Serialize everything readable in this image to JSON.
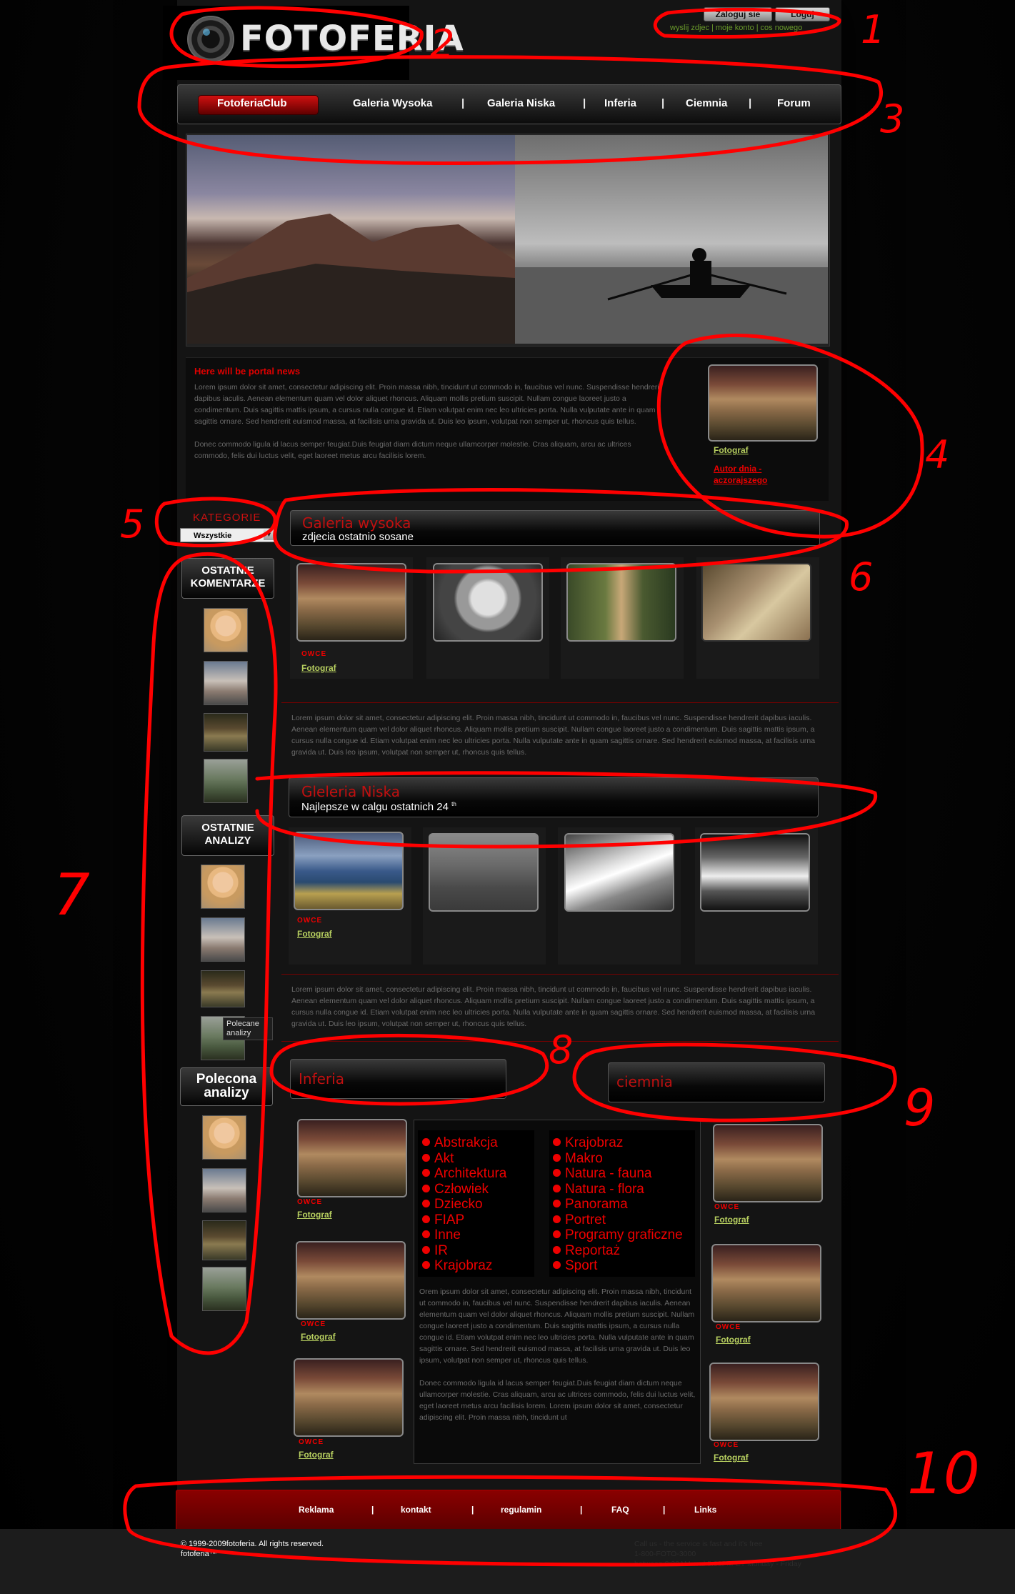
{
  "header": {
    "logo_text": "FOTOFERIA",
    "login_button": "Zaloguj sie",
    "logout_button": "Loguj",
    "top_links": [
      "wyslij zdjec",
      "moje konto",
      "cos nowego"
    ]
  },
  "nav": {
    "items": [
      "FotoferiaClub",
      "Galeria Wysoka",
      "Galeria Niska",
      "Inferia",
      "Ciemnia",
      "Forum"
    ],
    "separator": "|"
  },
  "news": {
    "title": "Here will be portal news",
    "paragraph1": "Lorem ipsum dolor sit amet, consectetur adipiscing elit. Proin massa nibh, tincidunt ut commodo in, faucibus vel nunc. Suspendisse hendrerit dapibus iaculis. Aenean elementum quam vel dolor aliquet rhoncus. Aliquam mollis pretium suscipit. Nullam congue laoreet justo a condimentum. Duis sagittis mattis ipsum, a cursus nulla congue id. Etiam volutpat enim nec leo ultricies porta. Nulla vulputate ante in quam sagittis ornare. Sed hendrerit euismod massa, at facilisis urna gravida ut. Duis leo ipsum, volutpat non semper ut, rhoncus quis tellus.",
    "paragraph2": "Donec commodo ligula id lacus semper feugiat.Duis feugiat diam dictum neque ullamcorper molestie. Cras aliquam, arcu ac ultrices commodo, felis dui luctus velit, eget laoreet metus arcu facilisis lorem."
  },
  "author_of_day": {
    "photographer_link": "Fotograf",
    "author_link": "Autor dnia - aczorajszego"
  },
  "sidebar": {
    "category_label": "KATEGORIE",
    "category_selected": "Wszystkie",
    "recent_comments": "OSTATNIE KOMENTARZE",
    "recent_analyses": "OSTATNIE ANALIZY",
    "recommended": "Polecona analizy",
    "tooltip": "Polecane analizy"
  },
  "gallery_high": {
    "title": "Galeria wysoka",
    "subtitle": "zdjecia ostatnio sosane",
    "caption_tag": "OWCE",
    "caption_link": "Fotograf"
  },
  "gallery_low": {
    "title": "Gleleria Niska",
    "subtitle": "Najlepsze w calgu ostatnich 24",
    "subtitle_sup": "th",
    "caption_tag": "OWCE",
    "caption_link": "Fotograf"
  },
  "lorem_block": "Lorem ipsum dolor sit amet, consectetur adipiscing elit. Proin massa nibh, tincidunt ut commodo in, faucibus vel nunc. Suspendisse hendrerit dapibus iaculis. Aenean elementum quam vel dolor aliquet rhoncus. Aliquam mollis pretium suscipit. Nullam congue laoreet justo a condimentum. Duis sagittis mattis ipsum, a cursus nulla congue id. Etiam volutpat enim nec leo ultricies porta. Nulla vulputate ante in quam sagittis ornare. Sed hendrerit euismod massa, at facilisis urna gravida ut. Duis leo ipsum, volutpat non semper ut, rhoncus quis tellus.",
  "inferia": {
    "title": "Inferia",
    "caption_tag": "OWCE",
    "caption_link": "Fotograf"
  },
  "ciemnia": {
    "title": "ciemnia",
    "caption_tag": "OWCE",
    "caption_link": "Fotograf"
  },
  "categories": {
    "left": [
      "Abstrakcja",
      "Akt",
      "Architektura",
      "Człowiek",
      "Dziecko",
      "FIAP",
      "Inne",
      "IR",
      "Krajobraz"
    ],
    "right": [
      "Krajobraz",
      "Makro",
      "Natura - fauna",
      "Natura - flora",
      "Panorama",
      "Portret",
      "Programy graficzne",
      "Reportaż",
      "Sport"
    ],
    "text1": "Orem ipsum dolor sit amet, consectetur adipiscing elit. Proin massa nibh, tincidunt ut commodo in, faucibus vel nunc. Suspendisse hendrerit dapibus iaculis. Aenean elementum quam vel dolor aliquet rhoncus. Aliquam mollis pretium suscipit. Nullam congue laoreet justo a condimentum. Duis sagittis mattis ipsum, a cursus nulla congue id. Etiam volutpat enim nec leo ultricies porta. Nulla vulputate ante in quam sagittis ornare. Sed hendrerit euismod massa, at facilisis urna gravida ut. Duis leo ipsum, volutpat non semper ut, rhoncus quis tellus.",
    "text2": "Donec commodo ligula id lacus semper feugiat.Duis feugiat diam dictum neque ullamcorper molestie. Cras aliquam, arcu ac ultrices commodo, felis dui luctus velit, eget laoreet metus arcu facilisis lorem. Lorem ipsum dolor sit amet, consectetur adipiscing elit. Proin massa nibh, tincidunt ut"
  },
  "footer": {
    "links": [
      "Reklama",
      "kontakt",
      "regulamin",
      "FAQ",
      "Links"
    ],
    "separator": "|",
    "copyright": "© 1999-2009fotoferia. All rights reserved.",
    "trademark": "fotoferia™",
    "callus": [
      "Call us - the service is fast and it's free",
      "1-800-FOTO-3000",
      "between 8:30AM and 5:00PM CT Monday - Friday"
    ]
  },
  "annotations": [
    "1",
    "2",
    "3",
    "4",
    "5",
    "6",
    "7",
    "8",
    "9",
    "10"
  ],
  "colors": {
    "accent_red": "#e00000",
    "nav_active": "#c01010",
    "link_green": "#b8d060",
    "footer_red": "#7a0000"
  }
}
